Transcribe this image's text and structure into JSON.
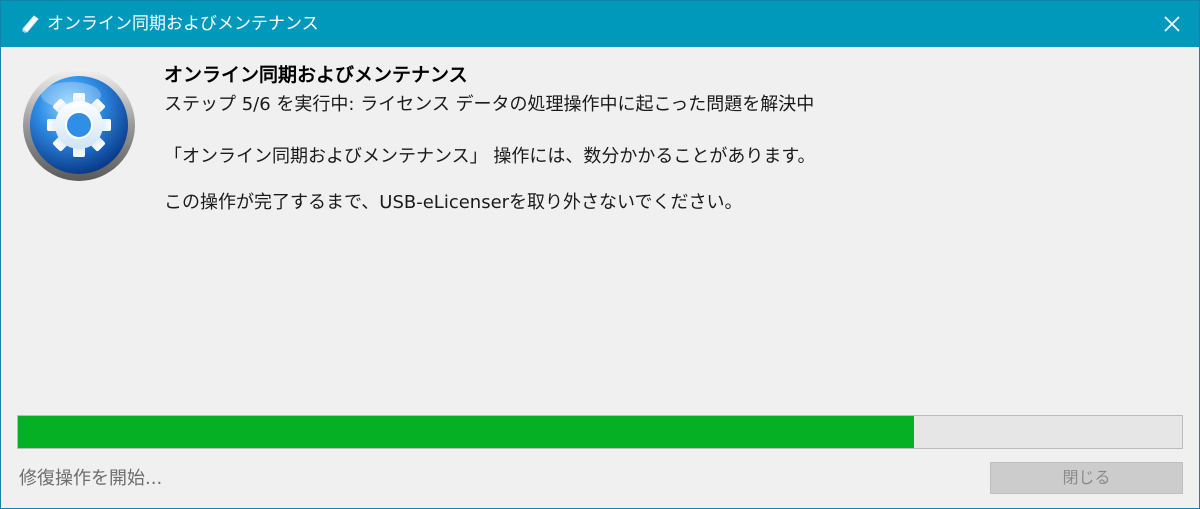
{
  "window": {
    "title": "オンライン同期およびメンテナンス"
  },
  "content": {
    "heading": "オンライン同期およびメンテナンス",
    "step_line": "ステップ 5/6 を実行中: ライセンス データの処理操作中に起こった問題を解決中",
    "note_line": "「オンライン同期およびメンテナンス」 操作には、数分かかることがあります。",
    "warning_line": "この操作が完了するまで、USB-eLicenserを取り外さないでください。"
  },
  "progress": {
    "value_percent": 77,
    "fill_color": "#06b025"
  },
  "footer": {
    "status_text": "修復操作を開始...",
    "close_button_label": "閉じる"
  },
  "icons": {
    "title": "eraser-icon",
    "close": "close-icon",
    "main": "gear-icon"
  }
}
